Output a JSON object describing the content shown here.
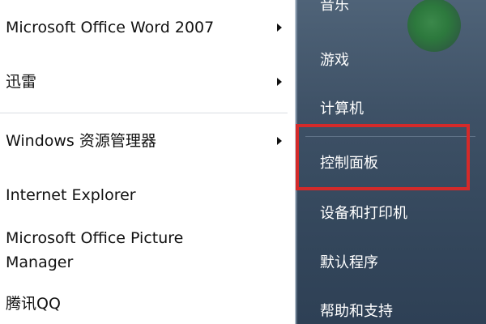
{
  "left_pane": {
    "items": [
      {
        "label": "Microsoft Office Word 2007",
        "has_submenu": true
      },
      {
        "label": "迅雷",
        "has_submenu": true
      },
      {
        "label": "Windows 资源管理器",
        "has_submenu": true
      },
      {
        "label": "Internet Explorer",
        "has_submenu": false
      },
      {
        "label": "Microsoft Office Picture\nManager",
        "has_submenu": false
      },
      {
        "label": "腾讯QQ",
        "has_submenu": false
      }
    ]
  },
  "right_pane": {
    "items": [
      {
        "label": "音乐"
      },
      {
        "label": "游戏"
      },
      {
        "label": "计算机"
      },
      {
        "label": "控制面板"
      },
      {
        "label": "设备和打印机"
      },
      {
        "label": "默认程序"
      },
      {
        "label": "帮助和支持"
      }
    ]
  },
  "highlight": {
    "target": "控制面板",
    "color": "#d42a2a"
  },
  "icons": {
    "submenu_arrow": "chevron-right-icon"
  }
}
